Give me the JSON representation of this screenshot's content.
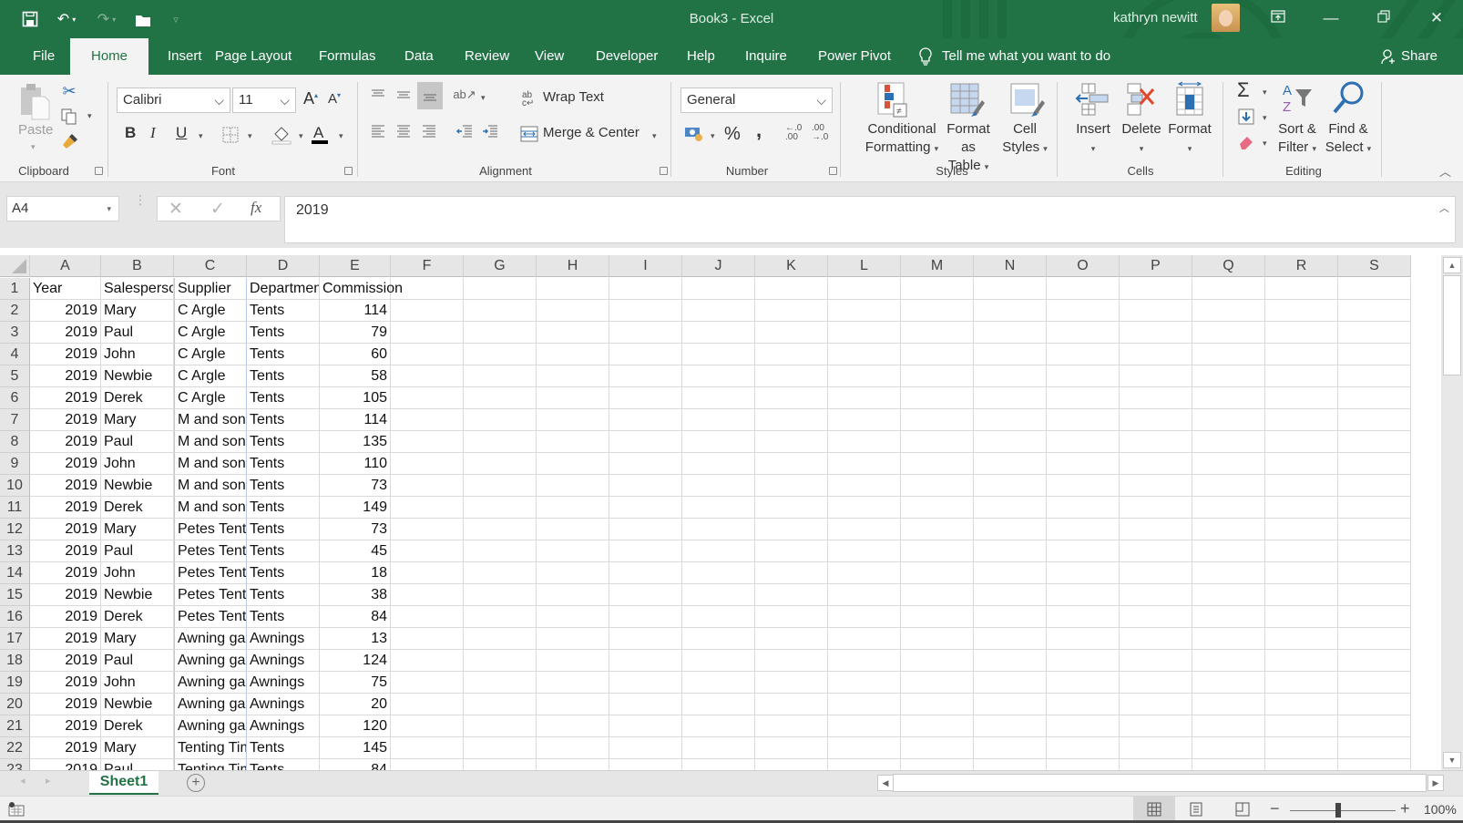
{
  "titlebar": {
    "title": "Book3  -  Excel",
    "user": "kathryn newitt",
    "qat_icons": [
      "save-icon",
      "undo-icon",
      "redo-icon",
      "open-icon",
      "customize-qat-icon"
    ]
  },
  "tabs": [
    {
      "label": "File"
    },
    {
      "label": "Home",
      "active": true
    },
    {
      "label": "Insert"
    },
    {
      "label": "Page Layout"
    },
    {
      "label": "Formulas"
    },
    {
      "label": "Data"
    },
    {
      "label": "Review"
    },
    {
      "label": "View"
    },
    {
      "label": "Developer"
    },
    {
      "label": "Help"
    },
    {
      "label": "Inquire"
    },
    {
      "label": "Power Pivot"
    }
  ],
  "tellme": "Tell me what you want to do",
  "share": "Share",
  "ribbon": {
    "clipboard": {
      "label": "Clipboard",
      "paste": "Paste"
    },
    "font": {
      "label": "Font",
      "name": "Calibri",
      "size": "11",
      "bold": "B",
      "italic": "I",
      "underline": "U"
    },
    "alignment": {
      "label": "Alignment",
      "wrap": "Wrap Text",
      "merge": "Merge & Center"
    },
    "number": {
      "label": "Number",
      "format": "General",
      "percent": "%",
      "comma": ",",
      "inc_decimal": "←.0 .00",
      "dec_decimal": ".00 →.0"
    },
    "styles": {
      "label": "Styles",
      "conditional": [
        "Conditional",
        "Formatting"
      ],
      "format_table": [
        "Format as",
        "Table"
      ],
      "cell_styles": [
        "Cell",
        "Styles"
      ]
    },
    "cells": {
      "label": "Cells",
      "insert": "Insert",
      "delete": "Delete",
      "format": "Format"
    },
    "editing": {
      "label": "Editing",
      "sort": [
        "Sort &",
        "Filter"
      ],
      "find": [
        "Find &",
        "Select"
      ],
      "sigma": "Σ"
    }
  },
  "formula_bar": {
    "name_box": "A4",
    "fx": "fx",
    "value": "2019"
  },
  "grid": {
    "columns": [
      "A",
      "B",
      "C",
      "D",
      "E",
      "F",
      "G",
      "H",
      "I",
      "J",
      "K",
      "L",
      "M",
      "N",
      "O",
      "P",
      "Q",
      "R",
      "S"
    ],
    "header_row": [
      "Year",
      "Salesperson",
      "Supplier",
      "Department",
      "Commission"
    ],
    "rows": [
      [
        2019,
        "Mary",
        "C Argle",
        "Tents",
        114
      ],
      [
        2019,
        "Paul",
        "C Argle",
        "Tents",
        79
      ],
      [
        2019,
        "John",
        "C Argle",
        "Tents",
        60
      ],
      [
        2019,
        "Newbie",
        "C Argle",
        "Tents",
        58
      ],
      [
        2019,
        "Derek",
        "C Argle",
        "Tents",
        105
      ],
      [
        2019,
        "Mary",
        "M and sons",
        "Tents",
        114
      ],
      [
        2019,
        "Paul",
        "M and sons",
        "Tents",
        135
      ],
      [
        2019,
        "John",
        "M and sons",
        "Tents",
        110
      ],
      [
        2019,
        "Newbie",
        "M and sons",
        "Tents",
        73
      ],
      [
        2019,
        "Derek",
        "M and sons",
        "Tents",
        149
      ],
      [
        2019,
        "Mary",
        "Petes Tents",
        "Tents",
        73
      ],
      [
        2019,
        "Paul",
        "Petes Tents",
        "Tents",
        45
      ],
      [
        2019,
        "John",
        "Petes Tents",
        "Tents",
        18
      ],
      [
        2019,
        "Newbie",
        "Petes Tents",
        "Tents",
        38
      ],
      [
        2019,
        "Derek",
        "Petes Tents",
        "Tents",
        84
      ],
      [
        2019,
        "Mary",
        "Awning galore",
        "Awnings",
        13
      ],
      [
        2019,
        "Paul",
        "Awning galore",
        "Awnings",
        124
      ],
      [
        2019,
        "John",
        "Awning galore",
        "Awnings",
        75
      ],
      [
        2019,
        "Newbie",
        "Awning galore",
        "Awnings",
        20
      ],
      [
        2019,
        "Derek",
        "Awning galore",
        "Awnings",
        120
      ],
      [
        2019,
        "Mary",
        "Tenting Times",
        "Tents",
        145
      ],
      [
        2019,
        "Paul",
        "Tenting Times",
        "Tents",
        84
      ]
    ]
  },
  "sheets": [
    {
      "label": "Sheet1",
      "active": true
    }
  ],
  "statusbar": {
    "zoom": "100%",
    "zoom_level_percent": 100
  }
}
